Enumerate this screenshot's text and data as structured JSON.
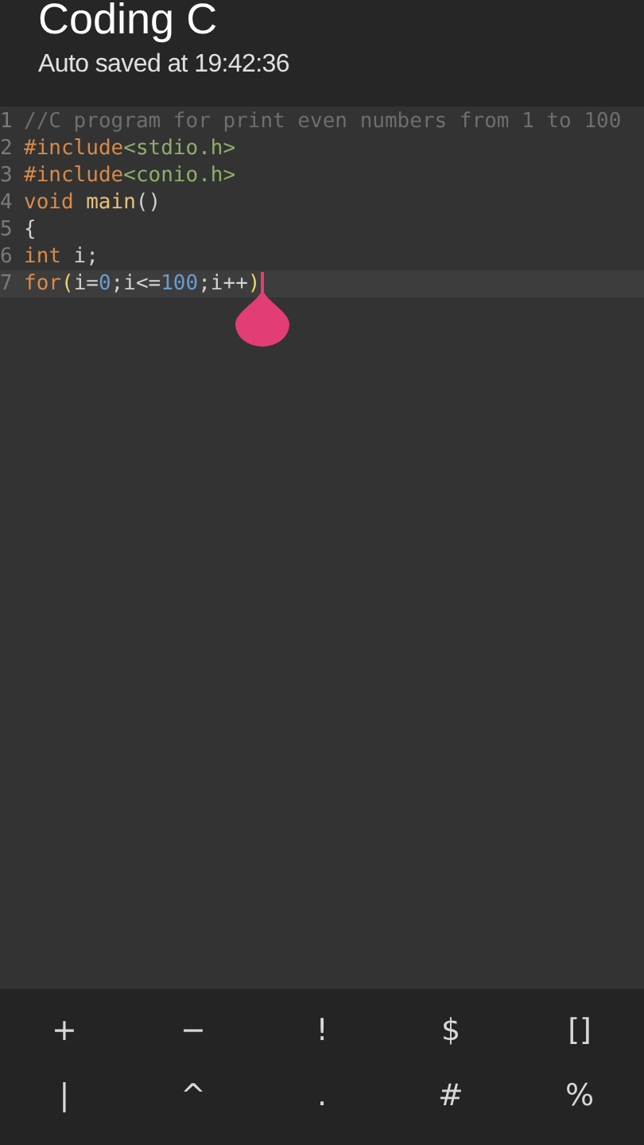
{
  "header": {
    "title": "Coding C",
    "subtitle": "Auto saved at 19:42:36"
  },
  "editor": {
    "lines": [
      {
        "number": "1",
        "current": false,
        "tokens": [
          {
            "kind": "comment",
            "text": "//C program for print even numbers from 1 to 100"
          }
        ]
      },
      {
        "number": "2",
        "current": false,
        "tokens": [
          {
            "kind": "keyword",
            "text": "#include"
          },
          {
            "kind": "string",
            "text": "<stdio.h>"
          }
        ]
      },
      {
        "number": "3",
        "current": false,
        "tokens": [
          {
            "kind": "keyword",
            "text": "#include"
          },
          {
            "kind": "string",
            "text": "<conio.h>"
          }
        ]
      },
      {
        "number": "4",
        "current": false,
        "tokens": [
          {
            "kind": "keyword",
            "text": "void"
          },
          {
            "kind": "function",
            "text": "main",
            "spaced": true
          },
          {
            "kind": "plain",
            "text": "()"
          }
        ]
      },
      {
        "number": "5",
        "current": false,
        "tokens": [
          {
            "kind": "plain",
            "text": "{"
          }
        ]
      },
      {
        "number": "6",
        "current": false,
        "tokens": [
          {
            "kind": "keyword",
            "text": "int"
          },
          {
            "kind": "plain",
            "text": " i;"
          }
        ]
      },
      {
        "number": "7",
        "current": true,
        "tokens": [
          {
            "kind": "keyword",
            "text": "for"
          },
          {
            "kind": "bracket",
            "text": "("
          },
          {
            "kind": "plain",
            "text": "i="
          },
          {
            "kind": "number",
            "text": "0"
          },
          {
            "kind": "plain",
            "text": ";i<="
          },
          {
            "kind": "number",
            "text": "100"
          },
          {
            "kind": "plain",
            "text": ";i++"
          },
          {
            "kind": "bracket",
            "text": ")"
          }
        ]
      }
    ]
  },
  "symbol_keys": [
    "+",
    "−",
    "!",
    "$",
    "[]",
    "|",
    "^",
    ".",
    "#",
    "%"
  ]
}
